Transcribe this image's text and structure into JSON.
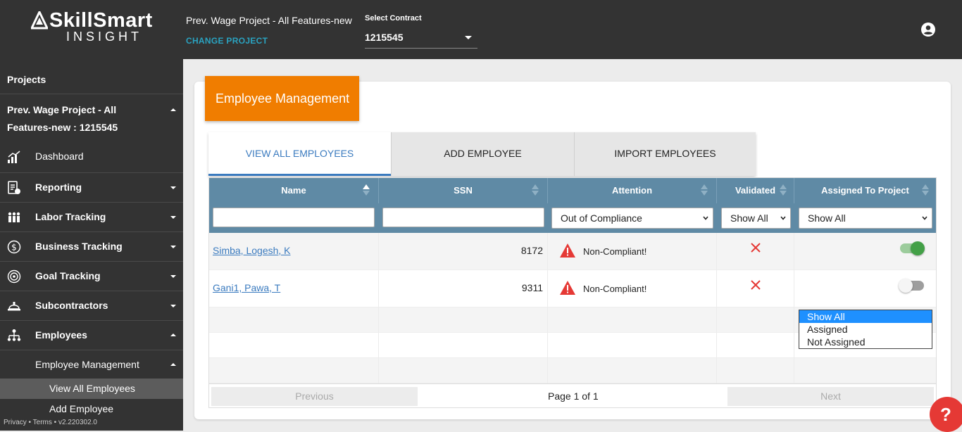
{
  "header": {
    "logo_main": "SkillSmart",
    "logo_sub": "INSIGHT",
    "project_title": "Prev. Wage Project - All Features-new",
    "change_project": "CHANGE PROJECT",
    "contract_label": "Select Contract",
    "contract_value": "1215545"
  },
  "sidebar": {
    "heading": "Projects",
    "project_name": "Prev. Wage Project - All Features-new : 1215545",
    "items": [
      {
        "label": "Dashboard",
        "icon": "dashboard-icon"
      },
      {
        "label": "Reporting",
        "icon": "reporting-icon"
      },
      {
        "label": "Labor Tracking",
        "icon": "labor-icon"
      },
      {
        "label": "Business Tracking",
        "icon": "dollar-icon"
      },
      {
        "label": "Goal Tracking",
        "icon": "target-icon"
      },
      {
        "label": "Subcontractors",
        "icon": "hardhat-icon"
      },
      {
        "label": "Employees",
        "icon": "org-chart-icon"
      }
    ],
    "employee_management": "Employee Management",
    "view_all": "View All Employees",
    "add_employee": "Add Employee",
    "footer": "Privacy • Terms • v2.220302.0"
  },
  "main": {
    "banner": "Employee Management",
    "tabs": [
      "VIEW ALL EMPLOYEES",
      "ADD EMPLOYEE",
      "IMPORT EMPLOYEES"
    ],
    "columns": [
      "Name",
      "SSN",
      "Attention",
      "Validated",
      "Assigned To Project"
    ],
    "filters": {
      "attention": "Out of Compliance",
      "validated": "Show All",
      "assigned": "Show All"
    },
    "rows": [
      {
        "name": "Simba, Logesh, K",
        "ssn": "8172",
        "attention": "Non-Compliant!",
        "assigned": true
      },
      {
        "name": "Gani1, Pawa, T",
        "ssn": "9311",
        "attention": "Non-Compliant!",
        "assigned": false
      }
    ],
    "pager": {
      "previous": "Previous",
      "page": "Page 1 of 1",
      "next": "Next"
    },
    "dropdown_options": [
      "Show All",
      "Assigned",
      "Not Assigned"
    ]
  },
  "colors": {
    "topbar": "#333333",
    "accent_orange": "#f07d00",
    "grid_header": "#5f8aa5",
    "link_blue": "#3b7bbf",
    "toggle_on": "#43a047",
    "error_red": "#e53935"
  }
}
